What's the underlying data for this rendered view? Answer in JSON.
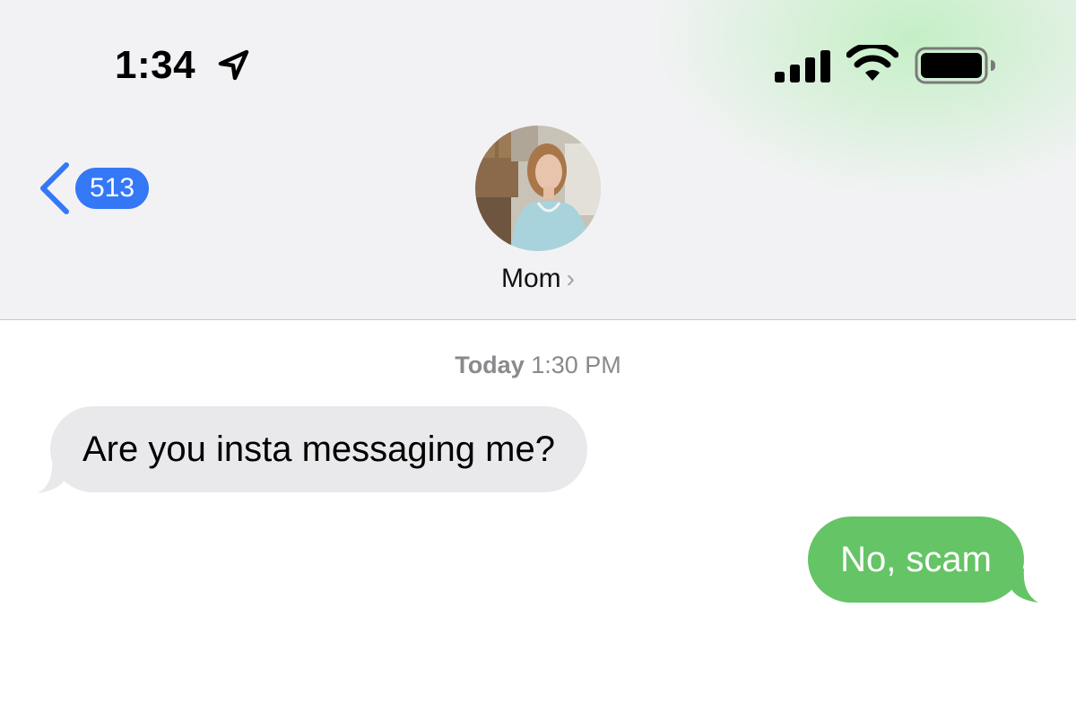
{
  "status_bar": {
    "time": "1:34",
    "icons": [
      "location-arrow-icon",
      "cellular-signal-icon",
      "wifi-icon",
      "battery-icon"
    ]
  },
  "nav": {
    "back_count": "513",
    "contact_name": "Mom",
    "contact_chevron": "›"
  },
  "conversation": {
    "timestamp_day": "Today",
    "timestamp_time": "1:30 PM",
    "messages": [
      {
        "direction": "incoming",
        "text": "Are you insta messaging me?"
      },
      {
        "direction": "outgoing",
        "text": "No, scam"
      }
    ]
  },
  "colors": {
    "accent_blue": "#3478f6",
    "outgoing_bubble": "#65c466",
    "incoming_bubble": "#e9e9eb",
    "header_background": "#f2f2f4"
  }
}
